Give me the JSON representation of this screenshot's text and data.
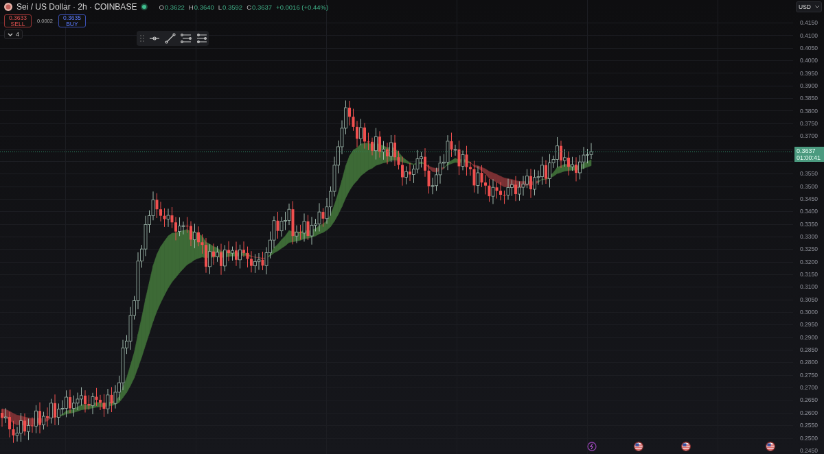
{
  "header": {
    "title": "Sei / US Dollar · 2h · COINBASE",
    "ohlc": [
      {
        "label": "O",
        "value": "0.3622"
      },
      {
        "label": "H",
        "value": "0.3640"
      },
      {
        "label": "L",
        "value": "0.3592"
      },
      {
        "label": "C",
        "value": "0.3637"
      }
    ],
    "change": "+0.0016 (+0.44%)"
  },
  "trade": {
    "sell": {
      "price": "0.3633",
      "label": "SELL"
    },
    "spread": "0.0002",
    "buy": {
      "price": "0.3635",
      "label": "BUY"
    }
  },
  "indicators_toggle": {
    "count": "4"
  },
  "price_axis": {
    "currency": "USD",
    "upper_labels": [
      "0.4150",
      "0.4100",
      "0.4050",
      "0.4000",
      "0.3950",
      "0.3900",
      "0.3850",
      "0.3800",
      "0.3750",
      "0.3700"
    ],
    "lower_labels": [
      "0.3550",
      "0.3500",
      "0.3450",
      "0.3400",
      "0.3350",
      "0.3300",
      "0.3250",
      "0.3200",
      "0.3150",
      "0.3100",
      "0.3050",
      "0.3000",
      "0.2950",
      "0.2900",
      "0.2850",
      "0.2800",
      "0.2750",
      "0.2700",
      "0.2650",
      "0.2600",
      "0.2550",
      "0.2500",
      "0.2450"
    ],
    "last_price": "0.3637",
    "countdown": "01:00:41"
  }
}
